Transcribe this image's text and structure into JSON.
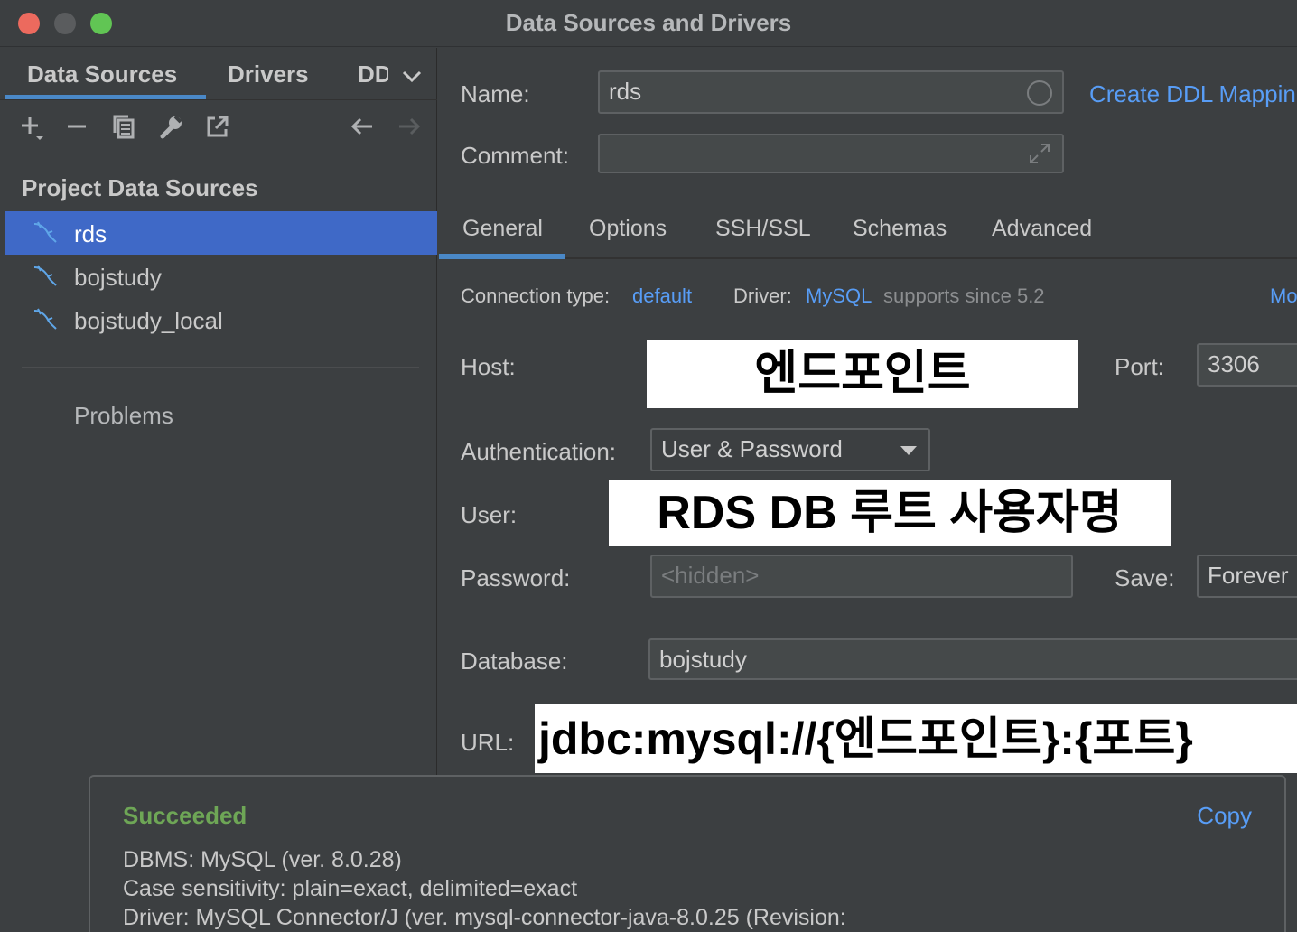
{
  "window": {
    "title": "Data Sources and Drivers"
  },
  "left_panel": {
    "tabs": [
      "Data Sources",
      "Drivers",
      "DD"
    ],
    "section_title": "Project Data Sources",
    "items": [
      {
        "label": "rds",
        "selected": true
      },
      {
        "label": "bojstudy",
        "selected": false
      },
      {
        "label": "bojstudy_local",
        "selected": false
      }
    ],
    "problems_label": "Problems"
  },
  "form": {
    "name_label": "Name:",
    "name_value": "rds",
    "comment_label": "Comment:",
    "comment_value": "",
    "ddl_link": "Create DDL Mappin"
  },
  "tabs": [
    "General",
    "Options",
    "SSH/SSL",
    "Schemas",
    "Advanced"
  ],
  "general": {
    "connection_type_label": "Connection type:",
    "connection_type_value": "default",
    "driver_label": "Driver:",
    "driver_value": "MySQL",
    "driver_note": "supports since 5.2",
    "more_link": "Mo",
    "host_label": "Host:",
    "host_overlay": "엔드포인트",
    "port_label": "Port:",
    "port_value": "3306",
    "auth_label": "Authentication:",
    "auth_value": "User & Password",
    "user_label": "User:",
    "user_overlay": "RDS DB 루트 사용자명",
    "password_label": "Password:",
    "password_placeholder": "<hidden>",
    "save_label": "Save:",
    "save_value": "Forever",
    "database_label": "Database:",
    "database_value": "bojstudy",
    "url_label": "URL:",
    "url_overlay": "jdbc:mysql://{엔드포인트}:{포트}"
  },
  "notification": {
    "title": "Succeeded",
    "copy_label": "Copy",
    "lines": [
      "DBMS: MySQL (ver. 8.0.28)",
      "Case sensitivity: plain=exact, delimited=exact",
      "Driver: MySQL Connector/J (ver. mysql-connector-java-8.0.25 (Revision:"
    ]
  },
  "colors": {
    "accent": "#4a88c7",
    "selection": "#3f69c7",
    "link": "#589df6",
    "success": "#6ea656",
    "background": "#3c3f41"
  },
  "icons": [
    "close-button",
    "minimize-button",
    "maximize-button",
    "add-icon",
    "remove-icon",
    "duplicate-icon",
    "wrench-icon",
    "export-icon",
    "arrow-left-icon",
    "arrow-right-icon",
    "chevron-down-icon",
    "mysql-dolphin-icon",
    "clear-circle-icon",
    "expand-icon",
    "dropdown-arrow-icon"
  ]
}
